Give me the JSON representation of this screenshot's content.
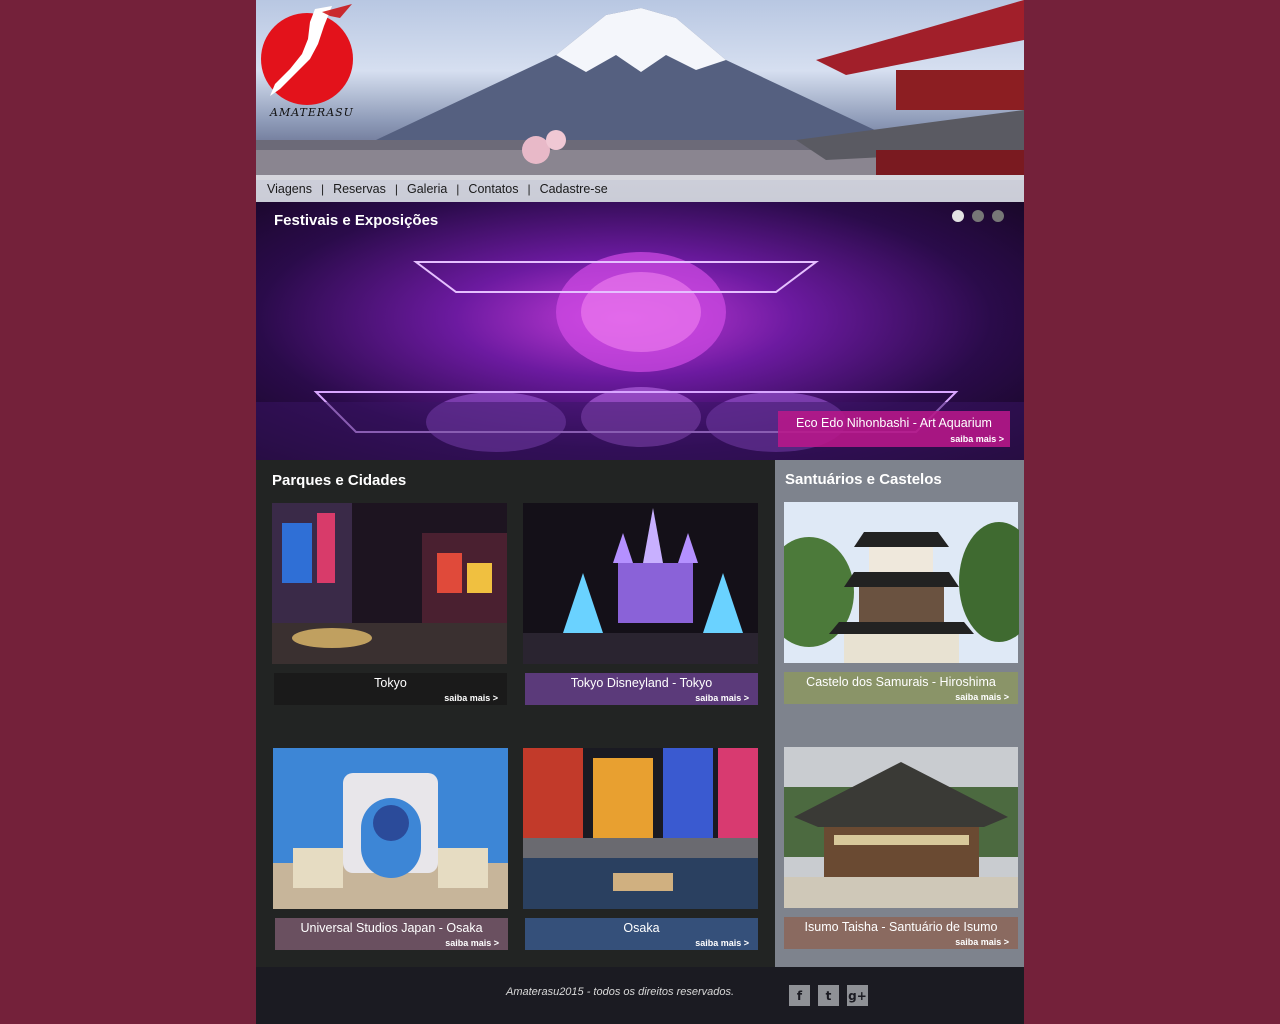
{
  "brand": {
    "logo_text": "AMATERASU"
  },
  "nav": {
    "items": [
      "Viagens",
      "Reservas",
      "Galeria",
      "Contatos",
      "Cadastre-se"
    ],
    "separator": "|"
  },
  "featured": {
    "title": "Festivais e Exposições",
    "slides": 3,
    "active_slide": 1,
    "caption": "Eco Edo Nihonbashi - Art Aquarium",
    "more": "saiba mais >"
  },
  "parks": {
    "title": "Parques e Cidades",
    "cards": [
      {
        "caption": "Tokyo",
        "more": "saiba mais >",
        "caption_color": "#1a1a1a"
      },
      {
        "caption": "Tokyo Disneyland - Tokyo",
        "more": "saiba mais >",
        "caption_color": "#5b3a7a"
      },
      {
        "caption": "Universal Studios Japan - Osaka",
        "more": "saiba mais >",
        "caption_color": "#6a5060"
      },
      {
        "caption": "Osaka",
        "more": "saiba mais >",
        "caption_color": "#35507a"
      }
    ]
  },
  "shrines": {
    "title": "Santuários e Castelos",
    "cards": [
      {
        "caption": "Castelo dos Samurais - Hiroshima",
        "more": "saiba mais >",
        "caption_color": "#8a9468"
      },
      {
        "caption": "Isumo Taisha - Santuário de Isumo",
        "more": "saiba mais >",
        "caption_color": "#8a6a60"
      }
    ]
  },
  "footer": {
    "copyright": "Amaterasu2015 - todos os direitos reservados.",
    "social": [
      {
        "icon": "facebook-icon",
        "glyph": "f"
      },
      {
        "icon": "twitter-icon",
        "glyph": "t"
      },
      {
        "icon": "google-plus-icon",
        "glyph": "g+"
      }
    ]
  },
  "colors": {
    "page_bg": "#74213a",
    "feature_caption": "#b8188a",
    "parks_bg": "#222423",
    "shrines_bg": "#7e838d",
    "footer_bg": "#1b1b22"
  }
}
